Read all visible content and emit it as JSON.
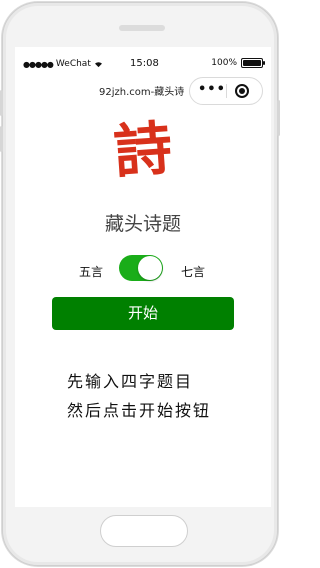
{
  "status_bar": {
    "carrier": "WeChat",
    "time": "15:08",
    "battery": "100%"
  },
  "nav": {
    "title": "92jzh.com-藏头诗",
    "more_icon": "more-icon",
    "close_icon": "target-icon"
  },
  "logo": {
    "char": "詩",
    "color": "#d8311b"
  },
  "app_title": "藏头诗题",
  "mode": {
    "left_label": "五言",
    "right_label": "七言",
    "toggle_on": true,
    "toggle_color": "#1aad19"
  },
  "start_button": {
    "label": "开始",
    "color": "#008000"
  },
  "hint": {
    "line1": "先输入四字题目",
    "line2": "然后点击开始按钮"
  }
}
